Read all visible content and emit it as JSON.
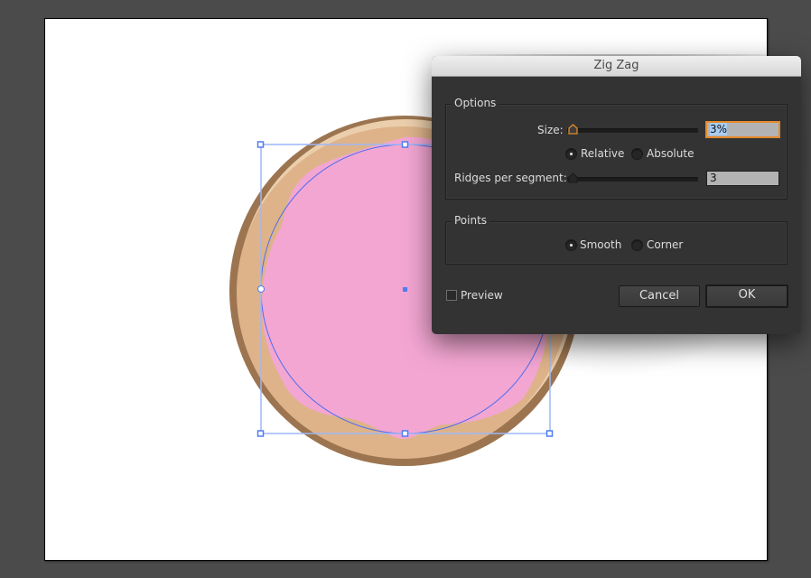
{
  "canvas": {
    "background_color": "#4b4b4b",
    "artboard_color": "#ffffff",
    "selection_color": "#4f7cf5",
    "artwork": {
      "name": "donut",
      "crust_color": "#9c7550",
      "dough_color": "#deb38a",
      "dough_highlight_color": "#ebcfac",
      "icing_color": "#f3a6d2"
    }
  },
  "dialog": {
    "title": "Zig Zag",
    "options": {
      "legend": "Options",
      "size_label": "Size:",
      "size_value": "3%",
      "size_slider_fraction": 0.0,
      "mode_options": [
        "Relative",
        "Absolute"
      ],
      "mode_selected": "Relative",
      "ridges_label": "Ridges per segment:",
      "ridges_value": "3",
      "ridges_slider_fraction": 0.0
    },
    "points": {
      "legend": "Points",
      "options": [
        "Smooth",
        "Corner"
      ],
      "selected": "Smooth"
    },
    "preview_label": "Preview",
    "preview_checked": false,
    "cancel_label": "Cancel",
    "ok_label": "OK",
    "accent_color": "#e58a2a"
  }
}
